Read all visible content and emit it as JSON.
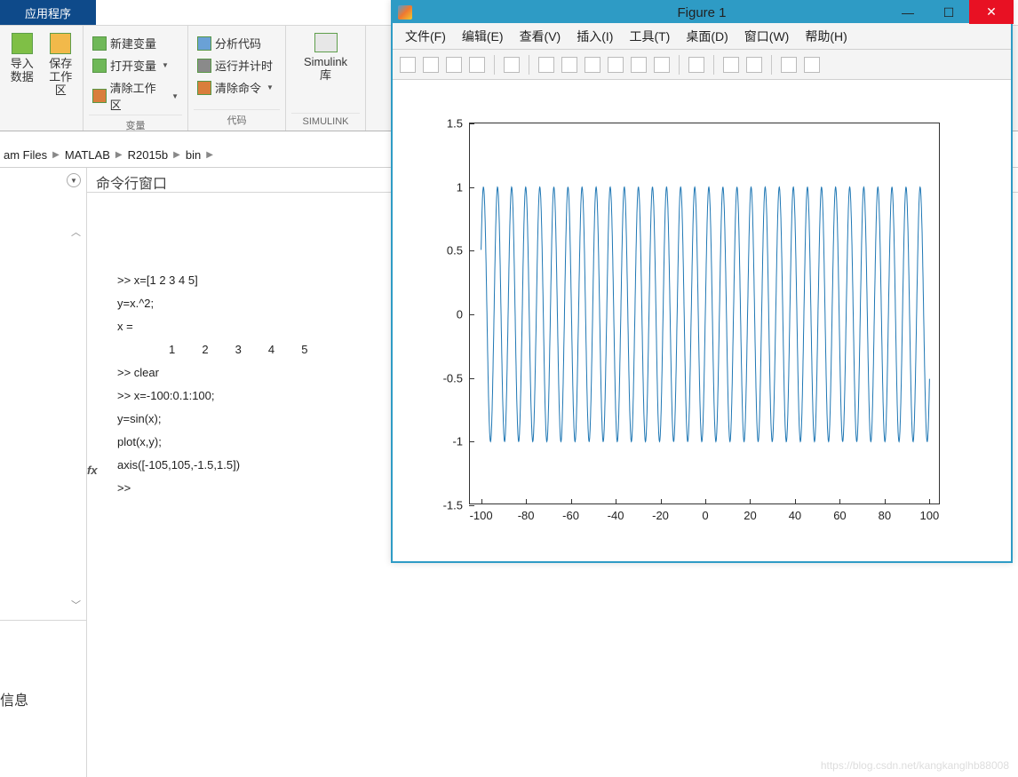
{
  "app": {
    "tab": "应用程序"
  },
  "ribbon": {
    "import": {
      "icon": "import-icon",
      "label1": "导入",
      "label2": "数据"
    },
    "save": {
      "icon": "save-icon",
      "label1": "保存",
      "label2": "工作区"
    },
    "var_group": {
      "new": "新建变量",
      "open": "打开变量",
      "clear": "清除工作区",
      "label": "变量"
    },
    "code_group": {
      "analyze": "分析代码",
      "run": "运行并计时",
      "clear": "清除命令",
      "label": "代码"
    },
    "simulink_group": {
      "name1": "Simulink",
      "name2": "库",
      "label": "SIMULINK"
    }
  },
  "breadcrumb": {
    "seg1": "am Files",
    "seg2": "MATLAB",
    "seg3": "R2015b",
    "seg4": "bin"
  },
  "left": {
    "bottom_text": "信息"
  },
  "cmd": {
    "title": "命令行窗口",
    "lines": [
      ">> x=[1 2 3 4 5]",
      "y=x.^2;",
      "",
      "x =",
      "",
      "     1     2     3     4     5",
      "",
      "",
      ">> clear",
      ">> x=-100:0.1:100;",
      "y=sin(x);",
      "plot(x,y);",
      "axis([-105,105,-1.5,1.5])",
      ">> "
    ],
    "fx": "fx"
  },
  "figure": {
    "title": "Figure 1",
    "menu": [
      "文件(F)",
      "编辑(E)",
      "查看(V)",
      "插入(I)",
      "工具(T)",
      "桌面(D)",
      "窗口(W)",
      "帮助(H)"
    ],
    "toolbar_icons": [
      "new-icon",
      "open-icon",
      "save-icon",
      "print-icon",
      "sep",
      "pointer-icon",
      "sep",
      "zoom-in-icon",
      "zoom-out-icon",
      "pan-icon",
      "rotate-icon",
      "data-cursor-icon",
      "brush-icon",
      "sep",
      "link-icon",
      "sep",
      "colorbar-icon",
      "legend-icon",
      "sep",
      "hide-icon",
      "dock-icon"
    ],
    "ylim": [
      -1.5,
      1.5
    ],
    "xlim": [
      -105,
      105
    ],
    "yticks": [
      -1.5,
      -1,
      -0.5,
      0,
      0.5,
      1,
      1.5
    ],
    "xticks": [
      -100,
      -80,
      -60,
      -40,
      -20,
      0,
      20,
      40,
      60,
      80,
      100
    ]
  },
  "chart_data": {
    "type": "line",
    "title": "",
    "xlabel": "",
    "ylabel": "",
    "xlim": [
      -105,
      105
    ],
    "ylim": [
      -1.5,
      1.5
    ],
    "function": "y = sin(x)",
    "x_range": {
      "start": -100,
      "stop": 100,
      "step": 0.1
    },
    "note": "Continuous sine curve plotted over 2001 points; values oscillate between -1 and 1 with period 2π ≈ 6.283.",
    "series": [
      {
        "name": "sin(x)",
        "color": "#1f77b4"
      }
    ]
  },
  "watermark": "https://blog.csdn.net/kangkanglhb88008"
}
